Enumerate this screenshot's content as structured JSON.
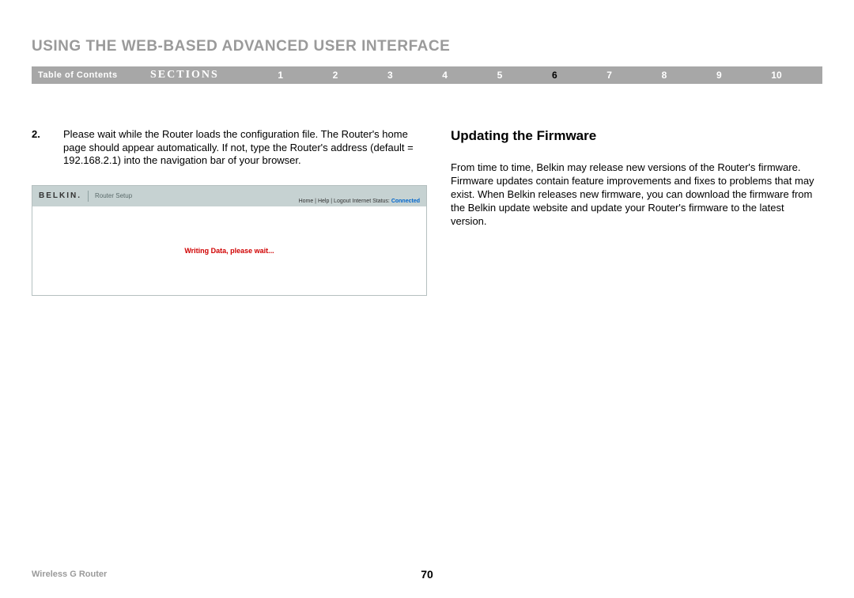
{
  "header": {
    "title": "USING THE WEB-BASED ADVANCED USER INTERFACE"
  },
  "nav": {
    "toc": "Table of Contents",
    "sections_label": "SECTIONS",
    "items": [
      "1",
      "2",
      "3",
      "4",
      "5",
      "6",
      "7",
      "8",
      "9",
      "10"
    ],
    "active_index": 5
  },
  "left": {
    "step_num": "2.",
    "step_text": "Please wait while the Router loads the configuration file. The Router's home page should appear automatically. If not, type the Router's address (default = 192.168.2.1) into the navigation bar of your browser.",
    "screenshot": {
      "logo": "BELKIN.",
      "title": "Router Setup",
      "links": "Home | Help | Logout   Internet Status:",
      "status": "Connected",
      "message": "Writing Data, please wait..."
    }
  },
  "right": {
    "heading": "Updating the Firmware",
    "body": "From time to time, Belkin may release new versions of the Router's firmware. Firmware updates contain feature improvements and fixes to problems that may exist. When Belkin releases new firmware, you can download the firmware from the Belkin update website and update your Router's firmware to the latest version."
  },
  "footer": {
    "product": "Wireless G Router",
    "page": "70"
  }
}
